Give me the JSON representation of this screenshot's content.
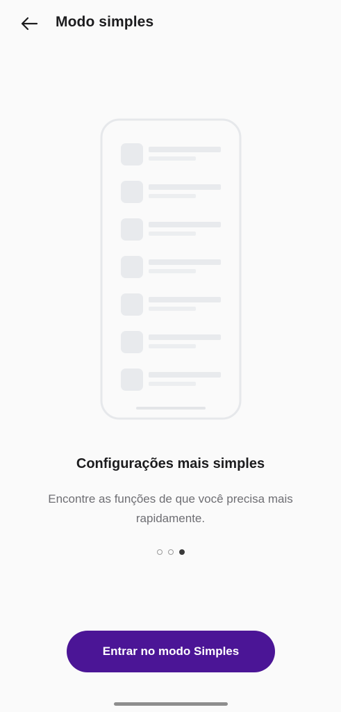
{
  "header": {
    "back_icon": "arrow-left-icon",
    "title": "Modo simples"
  },
  "illustration": {
    "description_icon": "phone-list-illustration",
    "rows": 7
  },
  "content": {
    "heading": "Configurações mais simples",
    "description": "Encontre as funções de que você precisa mais rapidamente."
  },
  "pager": {
    "total": 3,
    "active_index": 2
  },
  "action": {
    "button_label": "Entrar no modo Simples"
  },
  "colors": {
    "accent": "#4b1596",
    "background": "#fafafa"
  }
}
